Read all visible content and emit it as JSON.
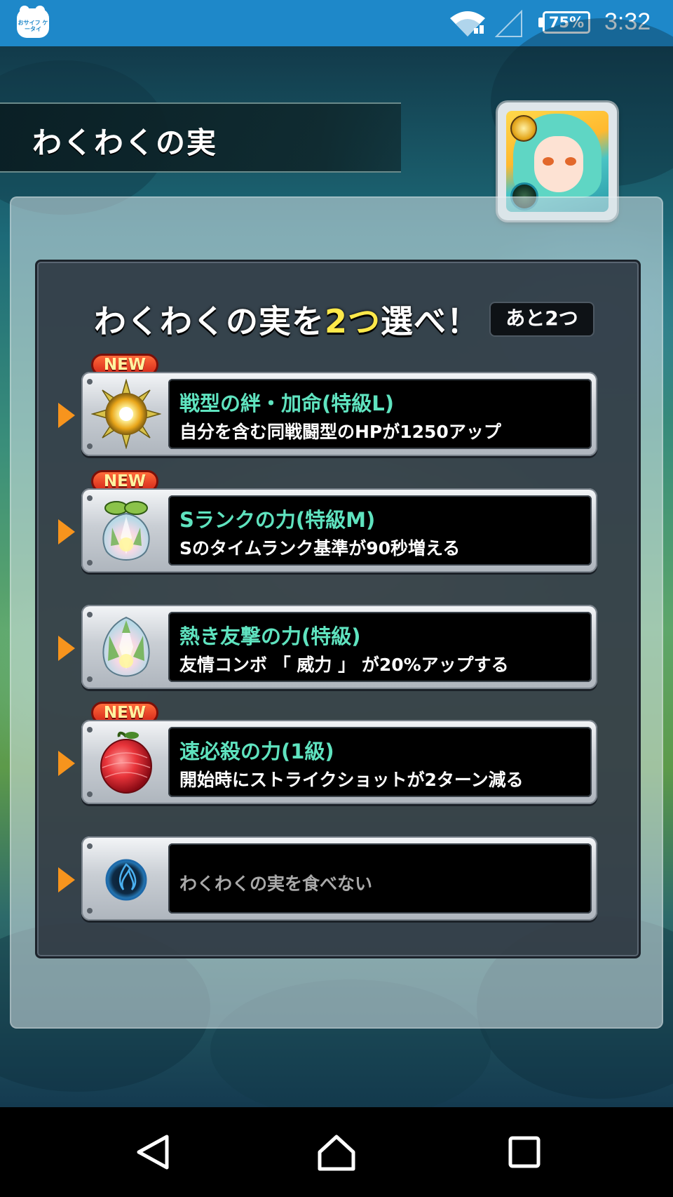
{
  "status_bar": {
    "app_icon_text": "おサイフ ケータイ",
    "battery": "75%",
    "time": "3:32"
  },
  "title": "わくわくの実",
  "heading": {
    "prefix": "わくわくの実を",
    "highlight": "2つ",
    "suffix": "選べ！"
  },
  "remaining": "あと2つ",
  "new_label": "NEW",
  "options": [
    {
      "name": "戦型の絆・加命(特級L)",
      "desc": "自分を含む同戦闘型のHPが1250アップ",
      "icon": "sun-flower-fruit-icon",
      "is_new": true
    },
    {
      "name": "Sランクの力(特級M)",
      "desc": "Sのタイムランク基準が90秒増える",
      "icon": "white-lotus-fruit-icon",
      "is_new": true
    },
    {
      "name": "熱き友撃の力(特級)",
      "desc": "友情コンボ 「 威力 」 が20%アップする",
      "icon": "white-lotus-fruit-icon",
      "is_new": false
    },
    {
      "name": "速必殺の力(1級)",
      "desc": "開始時にストライクショットが2ターン減る",
      "icon": "red-fruit-icon",
      "is_new": true
    },
    {
      "name": "",
      "desc": "わくわくの実を食べない",
      "icon": "blue-empty-orb-icon",
      "is_new": false
    }
  ],
  "colors": {
    "status_bar": "#1e88c9",
    "option_name": "#5fe3bf",
    "highlight": "#ffe94a",
    "arrow": "#f7941d",
    "new_badge": "#d6281a"
  }
}
